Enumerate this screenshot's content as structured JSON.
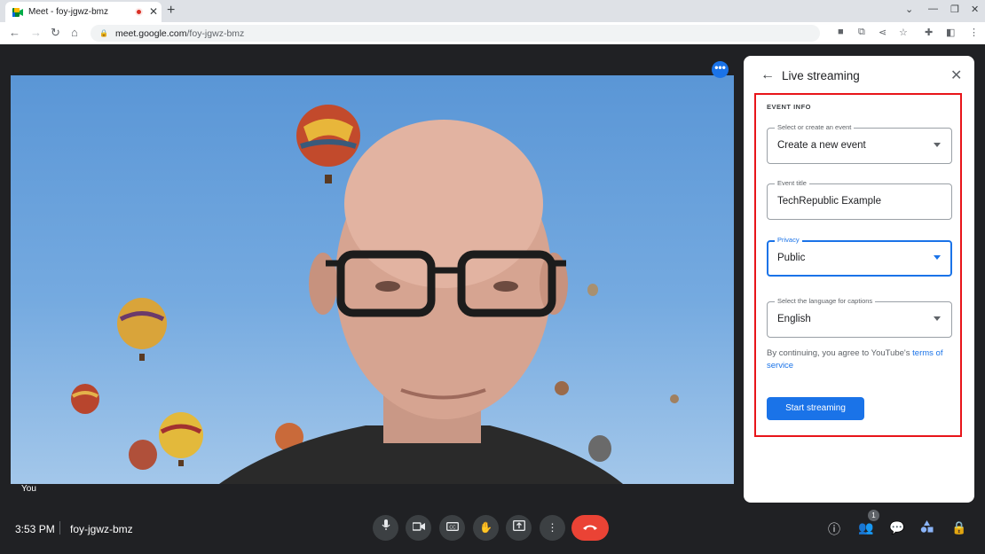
{
  "browser": {
    "tab_title": "Meet - foy-jgwz-bmz",
    "tab_close": "✕",
    "new_tab": "+",
    "url_host": "meet.google.com",
    "url_path": "/foy-jgwz-bmz"
  },
  "video": {
    "participant_label": "You",
    "more_label": "•••"
  },
  "panel": {
    "title": "Live streaming",
    "section_label": "EVENT INFO",
    "fields": [
      {
        "label": "Select or create an event",
        "value": "Create a new event"
      },
      {
        "label": "Event title",
        "value": "TechRepublic Example"
      },
      {
        "label": "Privacy",
        "value": "Public"
      },
      {
        "label": "Select the language for captions",
        "value": "English"
      }
    ],
    "tos_prefix": "By continuing, you agree to YouTube's ",
    "tos_link": "terms of service",
    "start_button": "Start streaming"
  },
  "bottom_bar": {
    "time": "3:53 PM",
    "meeting_code": "foy-jgwz-bmz",
    "people_count": "1"
  },
  "colors": {
    "accent": "#1a73e8",
    "highlight_box": "#e8151a",
    "end_call": "#ea4335"
  }
}
